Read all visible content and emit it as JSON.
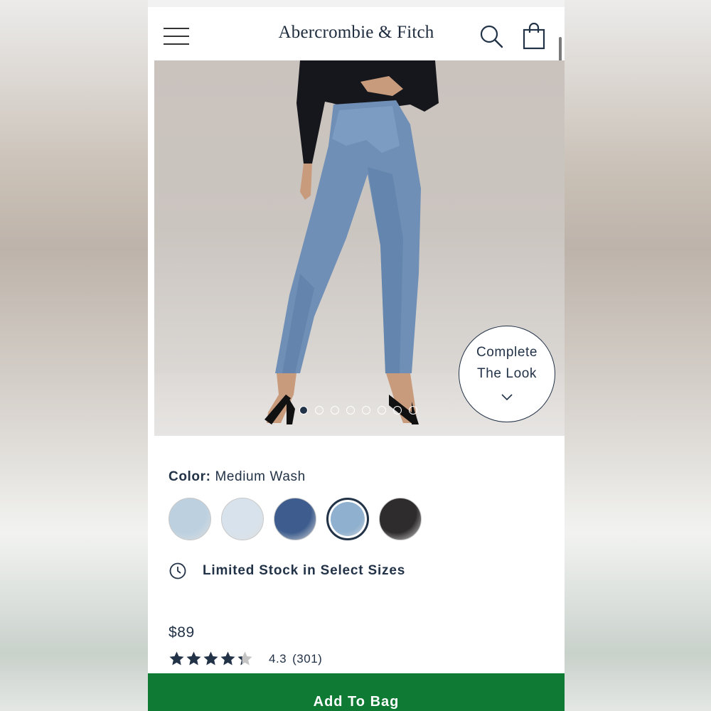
{
  "header": {
    "brand": "Abercrombie & Fitch",
    "menu_icon": "hamburger-menu-icon",
    "search_icon": "search-icon",
    "bag_icon": "shopping-bag-icon"
  },
  "hero": {
    "image_pager": {
      "total": 8,
      "active_index": 0
    },
    "complete_look": {
      "line1": "Complete",
      "line2": "The Look",
      "icon": "chevron-down-icon"
    }
  },
  "product": {
    "color_label": "Color:",
    "color_value": "Medium Wash",
    "swatches": [
      {
        "name": "light-destroyed-wash",
        "color": "#bcd0e0",
        "selected": false
      },
      {
        "name": "bleach-destroyed-wash",
        "color": "#d7e2ec",
        "selected": false
      },
      {
        "name": "dark-wash",
        "color": "#3e5d8e",
        "selected": false
      },
      {
        "name": "medium-wash",
        "color": "#8fb0cf",
        "selected": true
      },
      {
        "name": "black-wash",
        "color": "#2f2c2e",
        "selected": false
      }
    ],
    "stock_icon": "clock-icon",
    "stock_message": "Limited Stock in Select Sizes",
    "price": "$89",
    "rating_value": "4.3",
    "rating_count": "(301)",
    "rating_stars": 4.3
  },
  "cta": {
    "add_to_bag": "Add To Bag"
  },
  "colors": {
    "navy": "#223247",
    "cta_green": "#0f7a34"
  }
}
